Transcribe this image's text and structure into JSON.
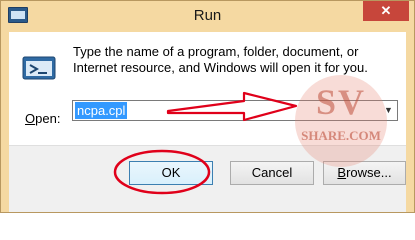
{
  "window": {
    "title": "Run",
    "close_icon": "close-icon",
    "app_icon": "run-app-icon"
  },
  "dialog": {
    "description": "Type the name of a program, folder, document, or Internet resource, and Windows will open it for you.",
    "open_label_prefix": "",
    "open_label_key": "O",
    "open_label_suffix": "pen:",
    "input_value": "ncpa.cpl",
    "dropdown_icon": "chevron-down-icon"
  },
  "buttons": {
    "ok": "OK",
    "cancel": "Cancel",
    "browse_prefix": "",
    "browse_key": "B",
    "browse_suffix": "rowse..."
  },
  "watermark": {
    "big": "SV",
    "small": "SHARE.COM"
  },
  "colors": {
    "titlebar": "#f5d9a2",
    "close": "#c7463b",
    "selection": "#3399ff",
    "annotation": "#e0001a"
  }
}
